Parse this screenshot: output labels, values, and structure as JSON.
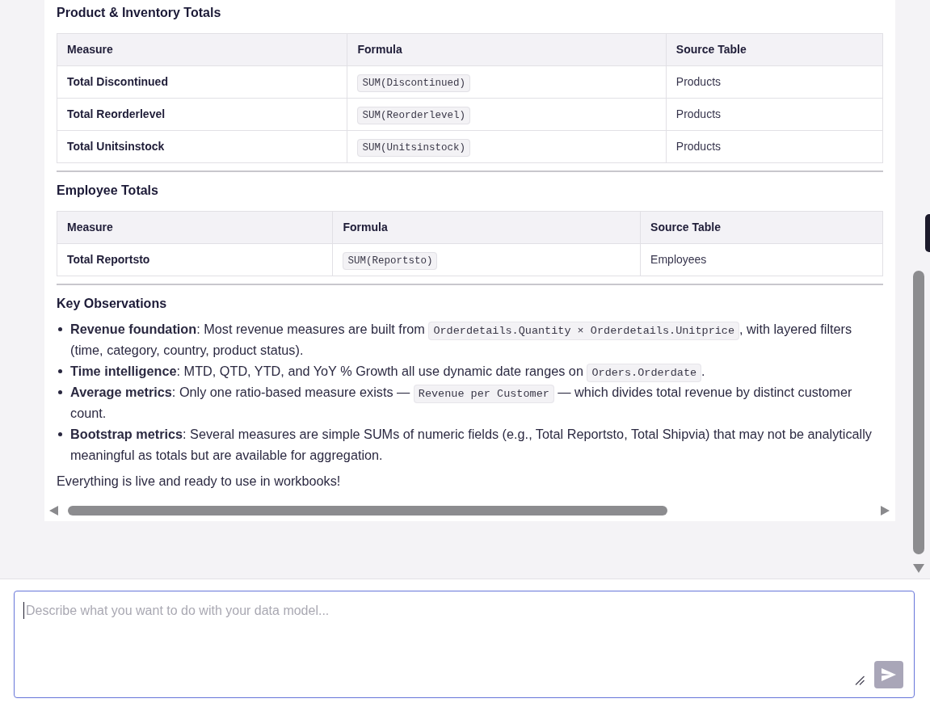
{
  "sections": [
    {
      "title": "Product & Inventory Totals",
      "table": {
        "columns": [
          {
            "label": "Measure",
            "kind": "name"
          },
          {
            "label": "Formula",
            "kind": "code"
          },
          {
            "label": "Source Table",
            "kind": "text"
          }
        ],
        "rows": [
          [
            "Total Discontinued",
            "SUM(Discontinued)",
            "Products"
          ],
          [
            "Total Reorderlevel",
            "SUM(Reorderlevel)",
            "Products"
          ],
          [
            "Total Unitsinstock",
            "SUM(Unitsinstock)",
            "Products"
          ]
        ]
      }
    },
    {
      "title": "Employee Totals",
      "table": {
        "columns": [
          {
            "label": "Measure",
            "kind": "name"
          },
          {
            "label": "Formula",
            "kind": "code"
          },
          {
            "label": "Source Table",
            "kind": "text"
          }
        ],
        "rows": [
          [
            "Total Reportsto",
            "SUM(Reportsto)",
            "Employees"
          ]
        ]
      }
    }
  ],
  "observations": {
    "title": "Key Observations",
    "items": [
      {
        "parts": [
          {
            "kind": "text",
            "text": "**Revenue foundation**: Most revenue measures are built from "
          },
          {
            "kind": "code",
            "text": "Orderdetails.Quantity × Orderdetails.Unitprice"
          },
          {
            "kind": "text",
            "text": ", with layered filters (time, category, country, product status)."
          }
        ]
      },
      {
        "parts": [
          {
            "kind": "text",
            "text": "**Time intelligence**: MTD, QTD, YTD, and YoY % Growth all use dynamic date ranges on "
          },
          {
            "kind": "code",
            "text": "Orders.Orderdate"
          },
          {
            "kind": "text",
            "text": "."
          }
        ]
      },
      {
        "parts": [
          {
            "kind": "text",
            "text": "**Average metrics**: Only one ratio-based measure exists — "
          },
          {
            "kind": "code",
            "text": "Revenue per Customer"
          },
          {
            "kind": "text",
            "text": " — which divides total revenue by distinct customer count."
          }
        ]
      },
      {
        "parts": [
          {
            "kind": "text",
            "text": "**Bootstrap metrics**: Several measures are simple SUMs of numeric fields (e.g., Total Reportsto, Total Shipvia) that may not be analytically meaningful as totals but are available for aggregation."
          }
        ]
      }
    ]
  },
  "closing": "Everything is live and ready to use in workbooks!",
  "composer": {
    "placeholder": "Describe what you want to do with your data model...",
    "focused": true,
    "send_disabled": true
  }
}
